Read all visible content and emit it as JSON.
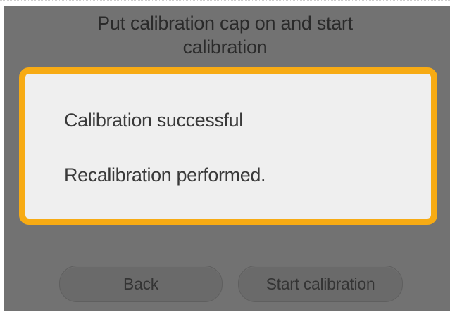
{
  "instruction": {
    "line1": "Put calibration cap on and start",
    "line2": "calibration"
  },
  "dialog": {
    "message": "Calibration successful",
    "detail": "Recalibration performed.",
    "border_color": "#f7ab14"
  },
  "buttons": {
    "back_label": "Back",
    "start_label": "Start calibration"
  }
}
